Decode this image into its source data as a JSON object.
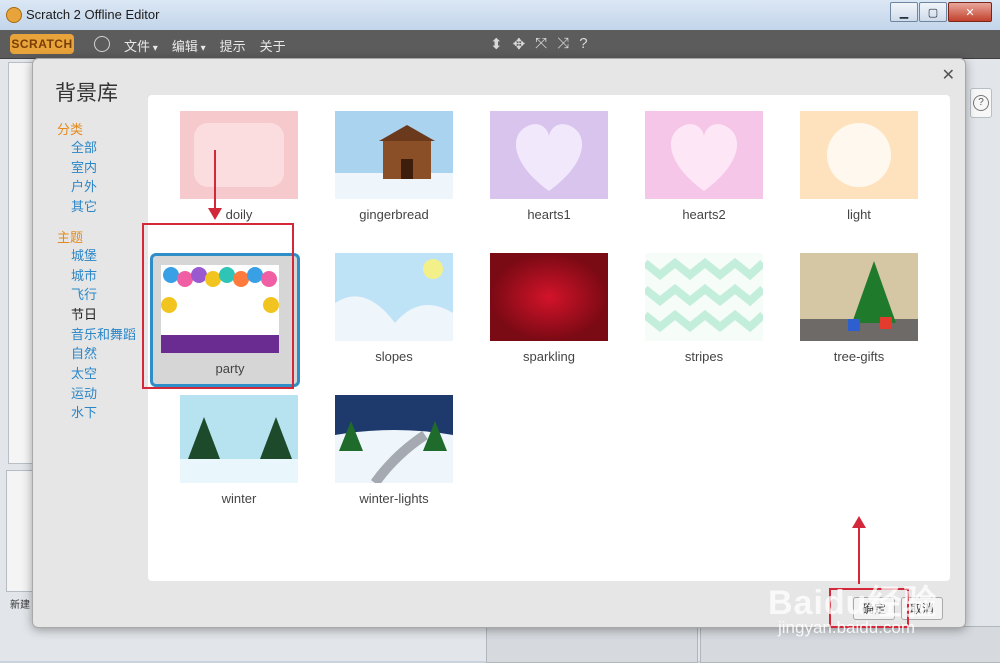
{
  "window": {
    "title": "Scratch 2 Offline Editor"
  },
  "menubar": {
    "logo": "SCRATCH",
    "items": [
      {
        "label": "文件",
        "caret": true
      },
      {
        "label": "编辑",
        "caret": true
      },
      {
        "label": "提示",
        "caret": false
      },
      {
        "label": "关于",
        "caret": false
      }
    ]
  },
  "dialog": {
    "title": "背景库",
    "groups": [
      {
        "title": "分类",
        "items": [
          "全部",
          "室内",
          "户外",
          "其它"
        ],
        "selected": null
      },
      {
        "title": "主题",
        "items": [
          "城堡",
          "城市",
          "飞行",
          "节日",
          "音乐和舞蹈",
          "自然",
          "太空",
          "运动",
          "水下"
        ],
        "selected": "节日"
      }
    ],
    "backdrops": [
      {
        "name": "doily"
      },
      {
        "name": "gingerbread"
      },
      {
        "name": "hearts1"
      },
      {
        "name": "hearts2"
      },
      {
        "name": "light"
      },
      {
        "name": "party",
        "selected": true
      },
      {
        "name": "slopes"
      },
      {
        "name": "sparkling"
      },
      {
        "name": "stripes"
      },
      {
        "name": "tree-gifts"
      },
      {
        "name": "winter"
      },
      {
        "name": "winter-lights"
      }
    ],
    "buttons": {
      "ok": "确定",
      "cancel": "取消"
    }
  },
  "sprite_panel": {
    "label": "新建"
  },
  "watermark": {
    "main": "Baidu经验",
    "sub": "jingyan.baidu.com"
  },
  "colors": {
    "accent": "#2f8ec8",
    "highlight": "#d3283a",
    "category_title": "#e48a1c",
    "link": "#2a86c7"
  }
}
